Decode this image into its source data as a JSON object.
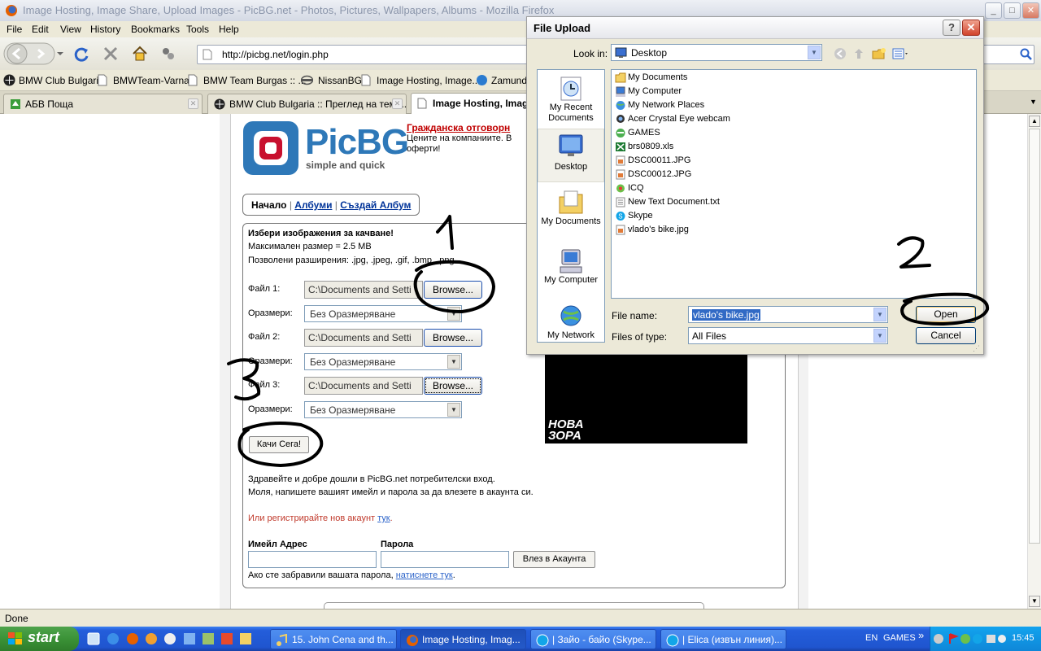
{
  "window": {
    "title": "Image Hosting, Image Share, Upload Images - PicBG.net - Photos, Pictures, Wallpapers, Albums - Mozilla Firefox",
    "minimize": "_",
    "maximize": "□",
    "close": "✕"
  },
  "menubar": [
    "File",
    "Edit",
    "View",
    "History",
    "Bookmarks",
    "Tools",
    "Help"
  ],
  "url": "http://picbg.net/login.php",
  "bookmarks": [
    "BMW Club Bulgaria",
    "BMWTeam-Varna",
    "BMW Team Burgas :: ...",
    "NissanBG",
    "Image Hosting, Image...",
    "Zamunda"
  ],
  "tabs": [
    {
      "label": "АБВ Поща"
    },
    {
      "label": "BMW Club Bulgaria :: Преглед на тема..."
    },
    {
      "label": "Image Hosting, Imag"
    }
  ],
  "site": {
    "logo_name": "PicBG",
    "logo_tagline": "simple and quick",
    "promo_title": "Гражданска отговорн",
    "promo_text_1": "Цените на компаниите. В",
    "promo_text_2": "оферти!",
    "nav": {
      "home": "Начало",
      "sep": "|",
      "albums": "Албуми",
      "create_album": "Създай Албум"
    },
    "upload": {
      "heading": "Избери изображения за качване!",
      "max_size": "Максимален размер = 2.5 MB",
      "allowed": "Позволени разширения: .jpg, .jpeg, .gif, .bmp, .png",
      "rows": [
        {
          "file_label": "Файл 1:",
          "file_value": "C:\\Documents and Setti",
          "browse": "Browse...",
          "size_label": "Оразмери:",
          "size_value": "Без Оразмеряване"
        },
        {
          "file_label": "Файл 2:",
          "file_value": "C:\\Documents and Setti",
          "browse": "Browse...",
          "size_label": "Оразмери:",
          "size_value": "Без Оразмеряване"
        },
        {
          "file_label": "Файл 3:",
          "file_value": "C:\\Documents and Setti",
          "browse": "Browse...",
          "size_label": "Оразмери:",
          "size_value": "Без Оразмеряване"
        }
      ],
      "submit": "Качи Сега!"
    },
    "banner_text": "НОВА ЗОРА",
    "welcome_1": "Здравейте и добре дошли в PicBG.net потребителски вход.",
    "welcome_2": "Моля, напишете вашият имейл и парола за да влезете в акаунта си.",
    "register_text": "Или регистрирайте нов акаунт",
    "register_link": "тук",
    "login": {
      "email_label": "Имейл Адрес",
      "password_label": "Парола",
      "submit": "Влез в Акаунта",
      "forgot_text": "Ако сте забравили вашата парола,",
      "forgot_link": "натиснете тук",
      "period": "."
    }
  },
  "status": "Done",
  "dialog": {
    "title": "File Upload",
    "help": "?",
    "close": "✕",
    "look_in_label": "Look in:",
    "look_in_value": "Desktop",
    "places": [
      "My Recent Documents",
      "Desktop",
      "My Documents",
      "My Computer",
      "My Network"
    ],
    "files": [
      "My Documents",
      "My Computer",
      "My Network Places",
      "Acer Crystal Eye webcam",
      "GAMES",
      "brs0809.xls",
      "DSC00011.JPG",
      "DSC00012.JPG",
      "ICQ",
      "New Text Document.txt",
      "Skype",
      "vlado's bike.jpg"
    ],
    "file_name_label": "File name:",
    "file_name_value": "vlado's bike.jpg",
    "file_type_label": "Files of type:",
    "file_type_value": "All Files",
    "open": "Open",
    "cancel": "Cancel"
  },
  "annotations": [
    "1",
    "2",
    "3"
  ],
  "taskbar": {
    "start": "start",
    "items": [
      "15. John Cena and th...",
      "Image Hosting, Imag...",
      "| Зайо - байо (Skype...",
      "| Elica (извън линия)..."
    ],
    "lang": "EN",
    "toolbar_label": "GAMES",
    "chevron": "»",
    "time": "15:45"
  },
  "colors": {
    "accent_red": "#c00000",
    "link_blue": "#003399",
    "logo_blue": "#2e78b8",
    "taskbar_blue": "#245edb",
    "scribble": "#000000"
  }
}
